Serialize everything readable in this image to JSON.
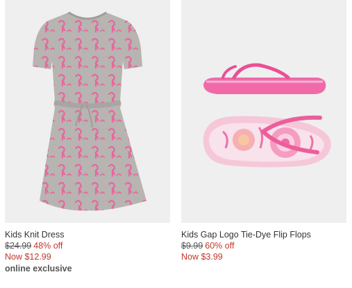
{
  "products": [
    {
      "name": "Kids Knit Dress",
      "original_price": "$24.99",
      "discount": "48% off",
      "sale_price": "Now $12.99",
      "badge": "online exclusive",
      "image_icon": "knit-dress-image"
    },
    {
      "name": "Kids Gap Logo Tie-Dye Flip Flops",
      "original_price": "$9.99",
      "discount": "60% off",
      "sale_price": "Now $3.99",
      "image_icon": "flip-flops-image"
    }
  ],
  "colors": {
    "sale_red": "#c0392b",
    "text": "#333333",
    "image_bg": "#efefef",
    "dress_gray": "#b7b4b1",
    "flamingo_pink": "#ec5e9b",
    "flipflop_pink": "#f06aa8"
  }
}
